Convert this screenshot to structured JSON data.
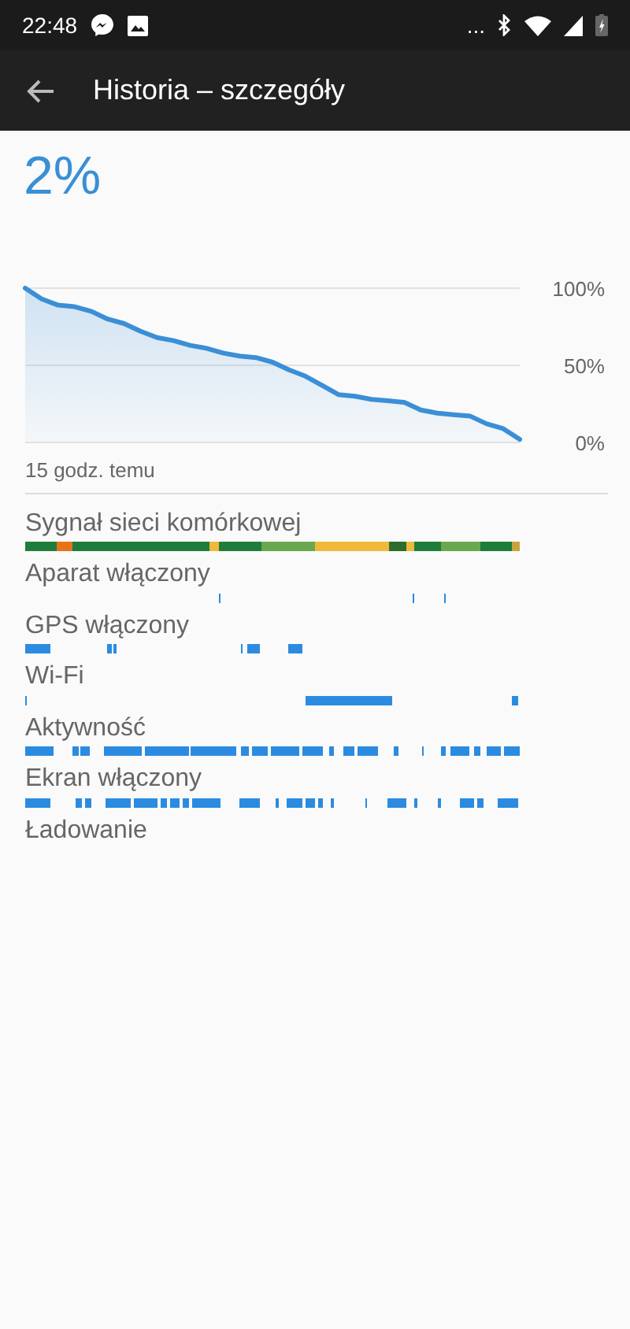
{
  "status_bar": {
    "time": "22:48",
    "overflow": "..."
  },
  "header": {
    "title": "Historia – szczegóły"
  },
  "battery_level": "2%",
  "chart": {
    "chart_data": {
      "type": "area",
      "series": [
        {
          "color": "#3a8fd6",
          "values": [
            100,
            93,
            89,
            88,
            85,
            80,
            77,
            72,
            68,
            66,
            63,
            61,
            58,
            56,
            55,
            52,
            47,
            43,
            37,
            31,
            30,
            28,
            27,
            26,
            21,
            19,
            18,
            17,
            12,
            9,
            2
          ]
        }
      ],
      "ylim": [
        0,
        100
      ],
      "yticks": [
        {
          "value": 0,
          "label": "0%"
        },
        {
          "value": 50,
          "label": "50%"
        },
        {
          "value": 100,
          "label": "100%"
        }
      ]
    },
    "start_label": "15 godz. temu"
  },
  "timelines": [
    {
      "label": "Sygnał sieci komórkowej",
      "kind": "signal"
    },
    {
      "label": "Aparat włączony",
      "kind": "events"
    },
    {
      "label": "GPS włączony",
      "kind": "events"
    },
    {
      "label": "Wi-Fi",
      "kind": "events"
    },
    {
      "label": "Aktywność",
      "kind": "events"
    },
    {
      "label": "Ekran włączony",
      "kind": "events"
    },
    {
      "label": "Ładowanie",
      "kind": "none"
    }
  ]
}
